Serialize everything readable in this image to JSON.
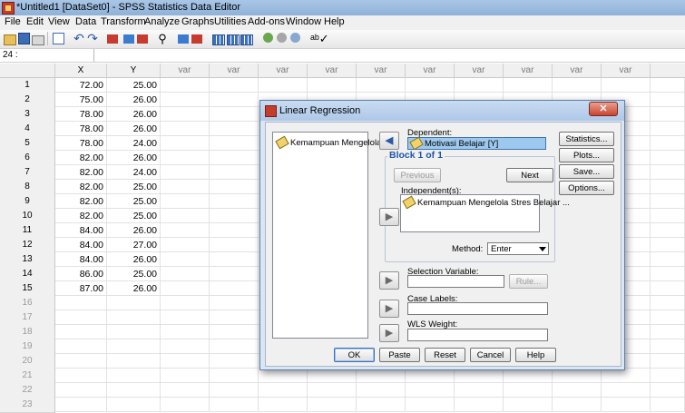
{
  "window": {
    "title": "*Untitled1 [DataSet0] - SPSS Statistics Data Editor"
  },
  "menu": [
    "File",
    "Edit",
    "View",
    "Data",
    "Transform",
    "Analyze",
    "Graphs",
    "Utilities",
    "Add-ons",
    "Window",
    "Help"
  ],
  "refbar": {
    "cell_ref": "24 :"
  },
  "grid": {
    "columns": [
      "X",
      "Y",
      "var",
      "var",
      "var",
      "var",
      "var",
      "var",
      "var",
      "var",
      "var",
      "var"
    ],
    "rows": [
      {
        "n": "1",
        "x": "72.00",
        "y": "25.00"
      },
      {
        "n": "2",
        "x": "75.00",
        "y": "26.00"
      },
      {
        "n": "3",
        "x": "78.00",
        "y": "26.00"
      },
      {
        "n": "4",
        "x": "78.00",
        "y": "26.00"
      },
      {
        "n": "5",
        "x": "78.00",
        "y": "24.00"
      },
      {
        "n": "6",
        "x": "82.00",
        "y": "26.00"
      },
      {
        "n": "7",
        "x": "82.00",
        "y": "24.00"
      },
      {
        "n": "8",
        "x": "82.00",
        "y": "25.00"
      },
      {
        "n": "9",
        "x": "82.00",
        "y": "25.00"
      },
      {
        "n": "10",
        "x": "82.00",
        "y": "25.00"
      },
      {
        "n": "11",
        "x": "84.00",
        "y": "26.00"
      },
      {
        "n": "12",
        "x": "84.00",
        "y": "27.00"
      },
      {
        "n": "13",
        "x": "84.00",
        "y": "26.00"
      },
      {
        "n": "14",
        "x": "86.00",
        "y": "25.00"
      },
      {
        "n": "15",
        "x": "87.00",
        "y": "26.00"
      }
    ],
    "empty_rows": [
      "16",
      "17",
      "18",
      "19",
      "20",
      "21",
      "22",
      "23"
    ]
  },
  "dialog": {
    "title": "Linear Regression",
    "close_glyph": "✕",
    "source_var": "Kemampuan Mengelola ...",
    "dependent_label": "Dependent:",
    "dependent_value": "Motivasi Belajar [Y]",
    "block_title": "Block 1 of 1",
    "previous": "Previous",
    "next": "Next",
    "independents_label": "Independent(s):",
    "independent_item": "Kemampuan Mengelola Stres Belajar ...",
    "method_label": "Method:",
    "method_value": "Enter",
    "selection_label": "Selection Variable:",
    "rule_button": "Rule...",
    "case_labels_label": "Case Labels:",
    "wls_label": "WLS Weight:",
    "side_buttons": [
      "Statistics...",
      "Plots...",
      "Save...",
      "Options..."
    ],
    "bottom_buttons": [
      "OK",
      "Paste",
      "Reset",
      "Cancel",
      "Help"
    ]
  }
}
